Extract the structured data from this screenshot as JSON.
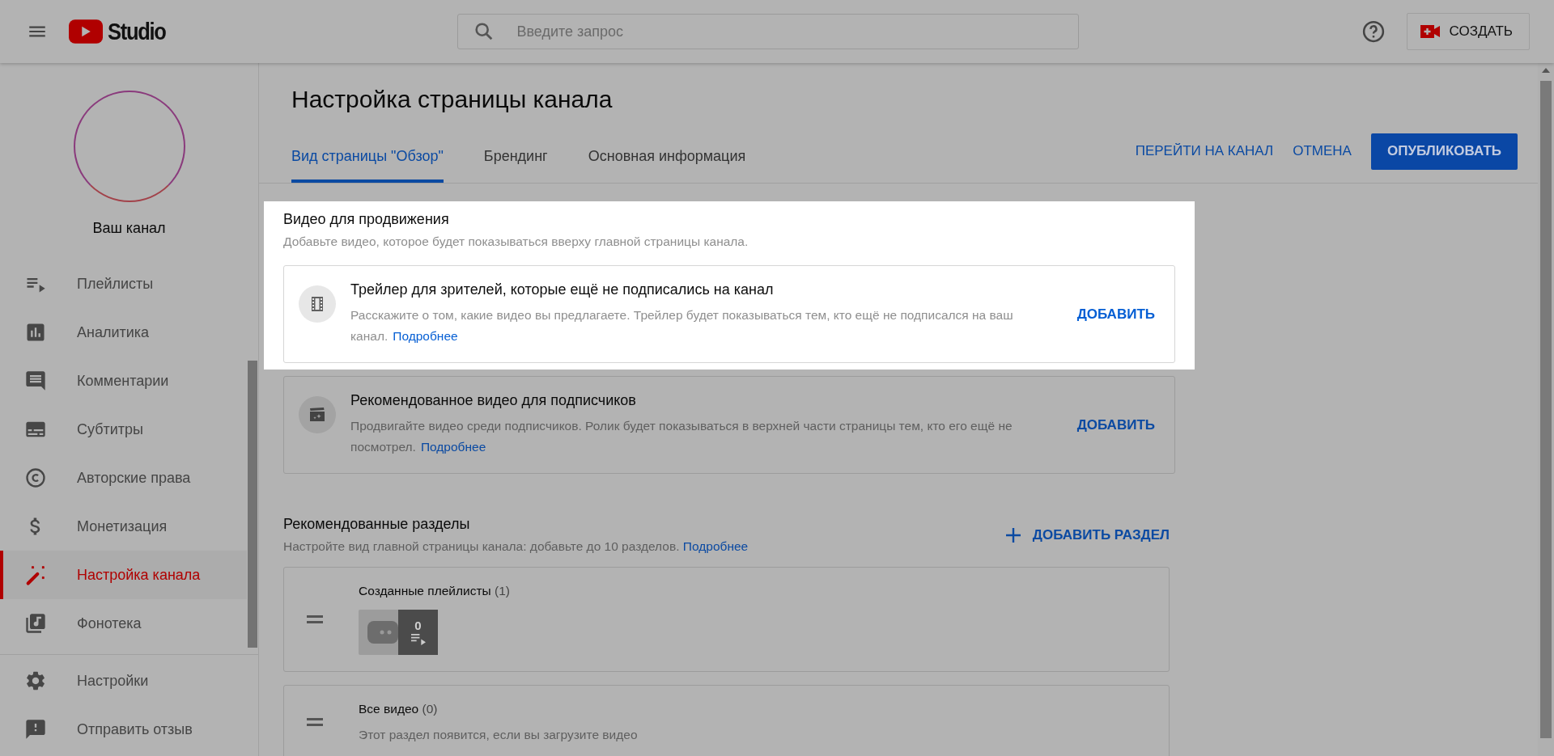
{
  "header": {
    "logo_text": "Studio",
    "search_placeholder": "Введите запрос",
    "create_label": "СОЗДАТЬ"
  },
  "sidebar": {
    "channel_label": "Ваш канал",
    "items": [
      {
        "label": "Плейлисты",
        "selected": false
      },
      {
        "label": "Аналитика",
        "selected": false
      },
      {
        "label": "Комментарии",
        "selected": false
      },
      {
        "label": "Субтитры",
        "selected": false
      },
      {
        "label": "Авторские права",
        "selected": false
      },
      {
        "label": "Монетизация",
        "selected": false
      },
      {
        "label": "Настройка канала",
        "selected": true
      },
      {
        "label": "Фонотека",
        "selected": false
      }
    ],
    "footer_items": [
      {
        "label": "Настройки"
      },
      {
        "label": "Отправить отзыв"
      }
    ]
  },
  "page": {
    "title": "Настройка страницы канала",
    "tabs": [
      {
        "label": "Вид страницы \"Обзор\"",
        "selected": true
      },
      {
        "label": "Брендинг",
        "selected": false
      },
      {
        "label": "Основная информация",
        "selected": false
      }
    ],
    "actions": [
      {
        "label": "ПЕРЕЙТИ НА КАНАЛ",
        "kind": "text"
      },
      {
        "label": "ОТМЕНА",
        "kind": "text"
      },
      {
        "label": "ОПУБЛИКОВАТЬ",
        "kind": "filled"
      }
    ]
  },
  "promo": {
    "title": "Видео для продвижения",
    "description": "Добавьте видео, которое будет показываться вверху главной страницы канала.",
    "highlighted": true,
    "cards": [
      {
        "title": "Трейлер для зрителей, которые ещё не подписались на канал",
        "description": "Расскажите о том, какие видео вы предлагаете. Трейлер будет показываться тем, кто ещё не подписался на ваш канал.",
        "link": "Подробнее",
        "action": "ДОБАВИТЬ",
        "highlighted": true
      },
      {
        "title": "Рекомендованное видео для подписчиков",
        "description": "Продвигайте видео среди подписчиков. Ролик будет показываться в верхней части страницы тем, кто его ещё не посмотрел.",
        "link": "Подробнее",
        "action": "ДОБАВИТЬ",
        "highlighted": false
      }
    ]
  },
  "sections": {
    "title": "Рекомендованные разделы",
    "description": "Настройте вид главной страницы канала: добавьте до 10 разделов.",
    "link": "Подробнее",
    "add_label": "ДОБАВИТЬ РАЗДЕЛ",
    "items": [
      {
        "kind": "playlists",
        "title": "Созданные плейлисты",
        "count": "(1)",
        "thumb_count": "0"
      },
      {
        "kind": "note",
        "title": "Все видео",
        "count": "(0)",
        "note": "Этот раздел появится, если вы загрузите видео"
      }
    ]
  }
}
